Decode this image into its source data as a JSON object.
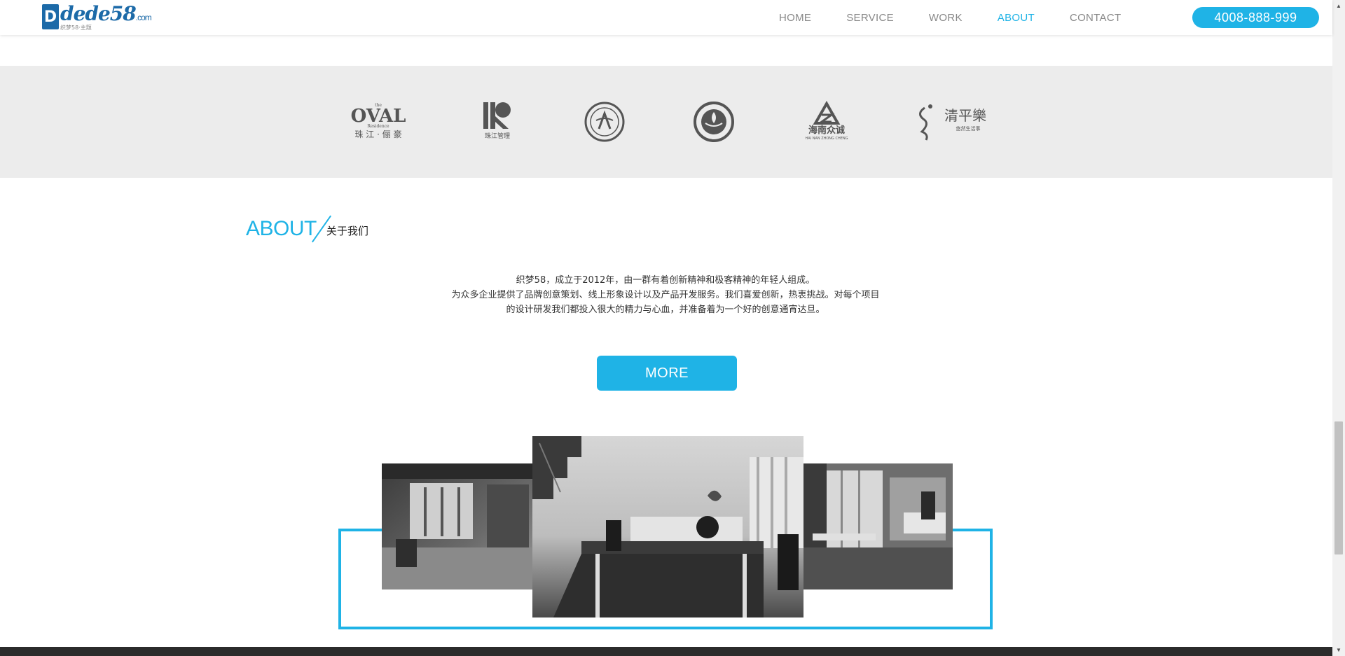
{
  "header": {
    "logo_text": "dede58",
    "logo_domain": ".com",
    "logo_sub": "织梦58·主题",
    "nav": [
      {
        "label": "HOME",
        "active": false
      },
      {
        "label": "SERVICE",
        "active": false
      },
      {
        "label": "WORK",
        "active": false
      },
      {
        "label": "ABOUT",
        "active": true
      },
      {
        "label": "CONTACT",
        "active": false
      }
    ],
    "phone": "4008-888-999"
  },
  "partners": {
    "logos": [
      {
        "name": "oval-residence-logo",
        "lines": [
          "the",
          "OVAL",
          "Residence",
          "珠 江 · 俪 豪"
        ]
      },
      {
        "name": "zhujiang-management-logo",
        "lines": [
          "珠江管理"
        ]
      },
      {
        "name": "university-seal-logo",
        "lines": []
      },
      {
        "name": "circular-emblem-logo",
        "lines": []
      },
      {
        "name": "hainan-zhongcheng-logo",
        "lines": [
          "海南众诚",
          "HAI NAN ZHONG CHENG"
        ]
      },
      {
        "name": "qingpinglue-logo",
        "lines": [
          "清平樂",
          "悠然生活事"
        ]
      }
    ]
  },
  "about": {
    "title_en": "ABOUT",
    "title_cn": "关于我们",
    "paragraph_lines": [
      "织梦58，成立于2012年，由一群有着创新精神和极客精神的年轻人组成。",
      "为众多企业提供了品牌创意策划、线上形象设计以及产品开发服务。我们喜爱创新，热衷挑战。对每个项目",
      "的设计研发我们都投入很大的精力与心血，并准备着为一个好的创意通宵达旦。"
    ],
    "more_label": "MORE"
  },
  "colors": {
    "accent": "#1fb3e6",
    "partners_bg": "#ececec",
    "footer": "#2b2b2b"
  }
}
